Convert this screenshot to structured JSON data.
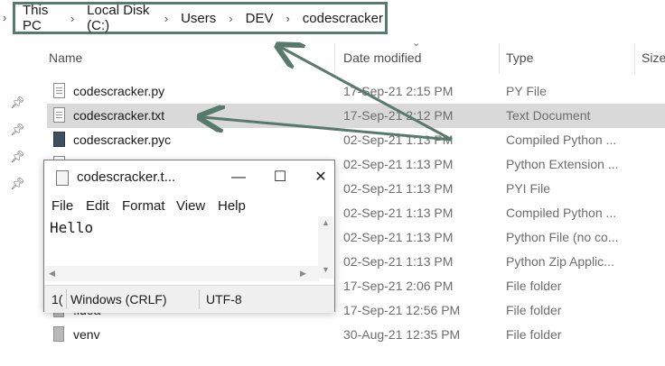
{
  "breadcrumb": {
    "items": [
      "This PC",
      "Local Disk (C:)",
      "Users",
      "DEV",
      "codescracker"
    ],
    "separator": "›"
  },
  "columns": {
    "name": "Name",
    "date": "Date modified",
    "type": "Type",
    "size": "Size"
  },
  "files": [
    {
      "name": "codescracker.py",
      "date": "17-Sep-21 2:15 PM",
      "type": "PY File",
      "icon": "python-file-icon"
    },
    {
      "name": "codescracker.txt",
      "date": "17-Sep-21 2:12 PM",
      "type": "Text Document",
      "icon": "text-file-icon",
      "selected": true
    },
    {
      "name": "codescracker.pyc",
      "date": "02-Sep-21 1:13 PM",
      "type": "Compiled Python ...",
      "icon": "compiled-python-icon"
    },
    {
      "name": "",
      "date": "02-Sep-21 1:13 PM",
      "type": "Python Extension ...",
      "icon": "file-icon"
    },
    {
      "name": "",
      "date": "02-Sep-21 1:13 PM",
      "type": "PYI File",
      "icon": "file-icon"
    },
    {
      "name": "",
      "date": "02-Sep-21 1:13 PM",
      "type": "Compiled Python ...",
      "icon": "file-icon"
    },
    {
      "name": "",
      "date": "02-Sep-21 1:13 PM",
      "type": "Python File (no co...",
      "icon": "file-icon"
    },
    {
      "name": "",
      "date": "02-Sep-21 1:13 PM",
      "type": "Python Zip Applic...",
      "icon": "file-icon"
    },
    {
      "name": "",
      "date": "17-Sep-21 2:06 PM",
      "type": "File folder",
      "icon": "folder-icon"
    },
    {
      "name": ".idea",
      "date": "17-Sep-21 12:56 PM",
      "type": "File folder",
      "icon": "folder-icon"
    },
    {
      "name": "venv",
      "date": "30-Aug-21 12:35 PM",
      "type": "File folder",
      "icon": "folder-icon"
    }
  ],
  "notepad": {
    "title": "codescracker.t...",
    "controls": {
      "minimize": "—",
      "maximize": "☐",
      "close": "✕"
    },
    "menu": [
      "File",
      "Edit",
      "Format",
      "View",
      "Help"
    ],
    "content": "Hello",
    "status": {
      "position": "1(",
      "line_ending": "Windows (CRLF)",
      "encoding": "UTF-8"
    }
  },
  "colors": {
    "accent": "#587a6c",
    "selected_row": "#d9d9d9"
  }
}
